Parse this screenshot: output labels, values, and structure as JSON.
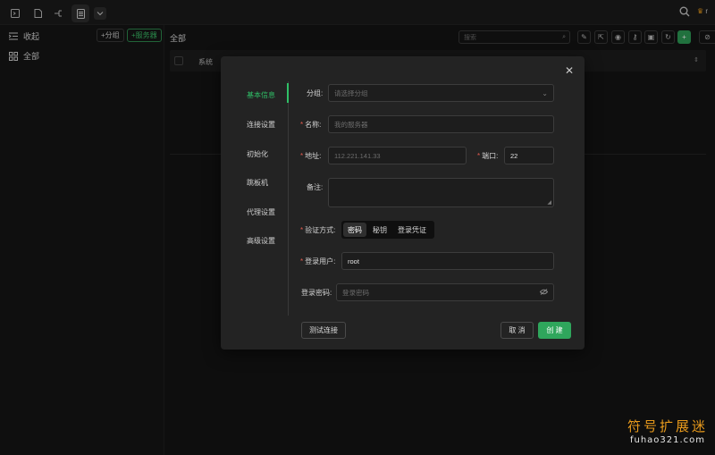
{
  "topbar": {
    "tabs": [
      {
        "icon": "terminal-icon"
      },
      {
        "icon": "file-icon"
      },
      {
        "icon": "network-icon"
      },
      {
        "icon": "server-list-icon",
        "active": true
      },
      {
        "icon": "chevron-down-icon"
      }
    ],
    "user_initial": "r"
  },
  "sidebar": {
    "collapse_label": "收起",
    "group_button": "+分组",
    "server_button": "+服务器",
    "all_label": "全部"
  },
  "main": {
    "title": "全部",
    "search_placeholder": "搜索",
    "toolbar_icons": [
      "edit-icon",
      "export-icon",
      "eye-icon",
      "key-icon",
      "image-icon",
      "refresh-icon",
      "add-icon"
    ],
    "table": {
      "columns": [
        "系统"
      ]
    }
  },
  "modal": {
    "nav": [
      "基本信息",
      "连接设置",
      "初始化",
      "跳板机",
      "代理设置",
      "高级设置"
    ],
    "active_nav": 0,
    "form": {
      "group_label": "分组:",
      "group_placeholder": "请选择分组",
      "name_label": "名称:",
      "name_placeholder": "我的服务器",
      "address_label": "地址:",
      "address_placeholder": "112.221.141.33",
      "port_label": "端口:",
      "port_value": "22",
      "remark_label": "备注:",
      "auth_label": "验证方式:",
      "auth_options": [
        "密码",
        "秘钥",
        "登录凭证"
      ],
      "auth_selected": 0,
      "user_label": "登录用户:",
      "user_value": "root",
      "password_label": "登录密码:",
      "password_placeholder": "登录密码"
    },
    "buttons": {
      "test": "测试连接",
      "cancel": "取 消",
      "create": "创 建"
    }
  },
  "watermark": {
    "cn": "符号扩展迷",
    "url": "fuhao321.com"
  },
  "colors": {
    "accent": "#2fa65c",
    "required": "#e05a4e",
    "watermark": "#e89a1c"
  }
}
